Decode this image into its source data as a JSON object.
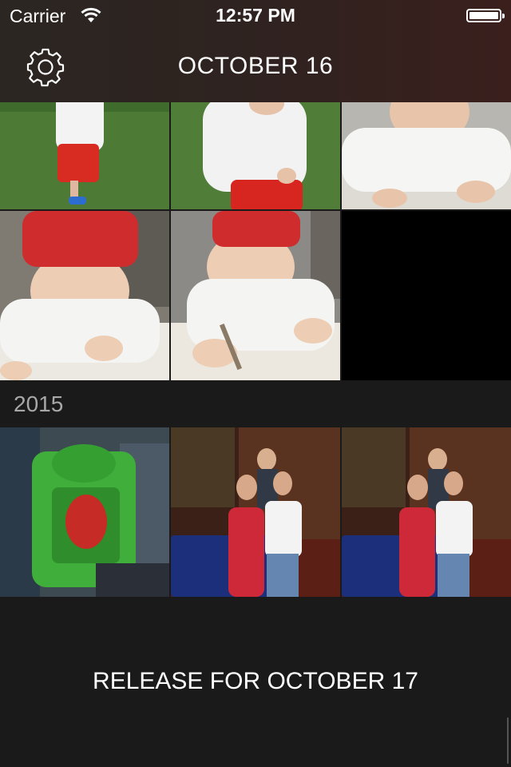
{
  "status_bar": {
    "carrier": "Carrier",
    "time": "12:57 PM"
  },
  "nav": {
    "title": "OCTOBER 16",
    "settings_icon": "gear-icon"
  },
  "sections": [
    {
      "label": ""
    },
    {
      "label": "2015"
    }
  ],
  "footer": {
    "release_text": "RELEASE FOR OCTOBER 17"
  }
}
